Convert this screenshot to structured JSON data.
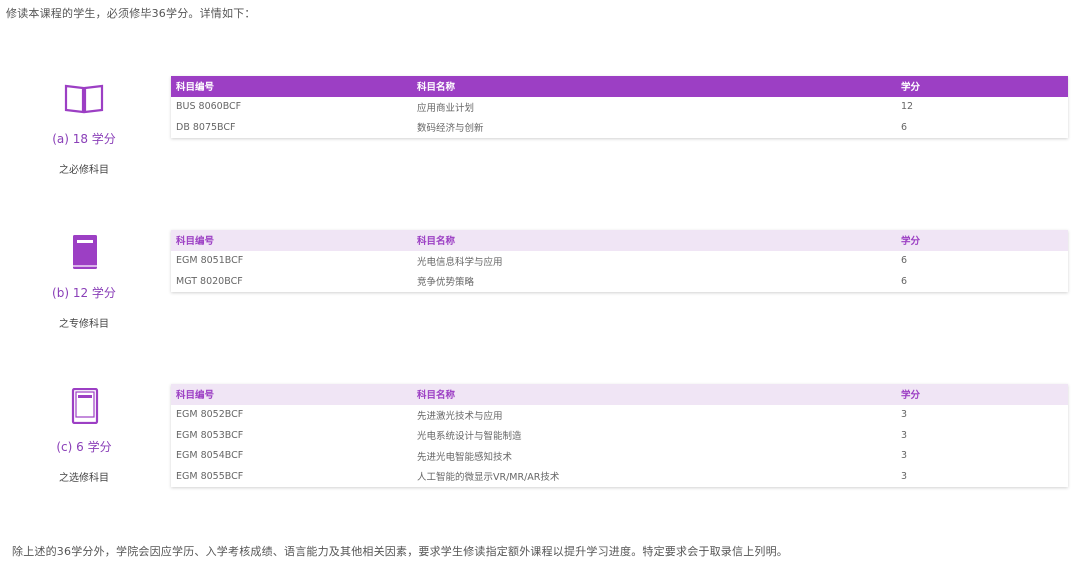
{
  "intro": "修读本课程的学生，必须修毕36学分。详情如下：",
  "columns": {
    "code": "科目编号",
    "name": "科目名称",
    "credit": "学分"
  },
  "groups": [
    {
      "icon": "open-book-icon",
      "credits_label": "(a) 18 学分",
      "kind_label": "之必修科目",
      "rows": [
        {
          "code": "BUS 8060BCF",
          "name": "应用商业计划",
          "credit": "12"
        },
        {
          "code": "DB 8075BCF",
          "name": "数码经济与创新",
          "credit": "6"
        }
      ]
    },
    {
      "icon": "filled-book-icon",
      "credits_label": "(b) 12 学分",
      "kind_label": "之专修科目",
      "rows": [
        {
          "code": "EGM 8051BCF",
          "name": "光电信息科学与应用",
          "credit": "6"
        },
        {
          "code": "MGT 8020BCF",
          "name": "竞争优势策略",
          "credit": "6"
        }
      ]
    },
    {
      "icon": "outline-book-icon",
      "credits_label": "(c) 6 学分",
      "kind_label": "之选修科目",
      "rows": [
        {
          "code": "EGM 8052BCF",
          "name": "先进激光技术与应用",
          "credit": "3"
        },
        {
          "code": "EGM 8053BCF",
          "name": "光电系统设计与智能制造",
          "credit": "3"
        },
        {
          "code": "EGM 8054BCF",
          "name": "先进光电智能感知技术",
          "credit": "3"
        },
        {
          "code": "EGM 8055BCF",
          "name": "人工智能的微显示VR/MR/AR技术",
          "credit": "3"
        }
      ]
    }
  ],
  "footer": "除上述的36学分外，学院会因应学历、入学考核成绩、语言能力及其他相关因素，要求学生修读指定额外课程以提升学习进度。特定要求会于取录信上列明。",
  "colors": {
    "accent": "#9c3fc4",
    "header_light": "#f0e5f5"
  }
}
